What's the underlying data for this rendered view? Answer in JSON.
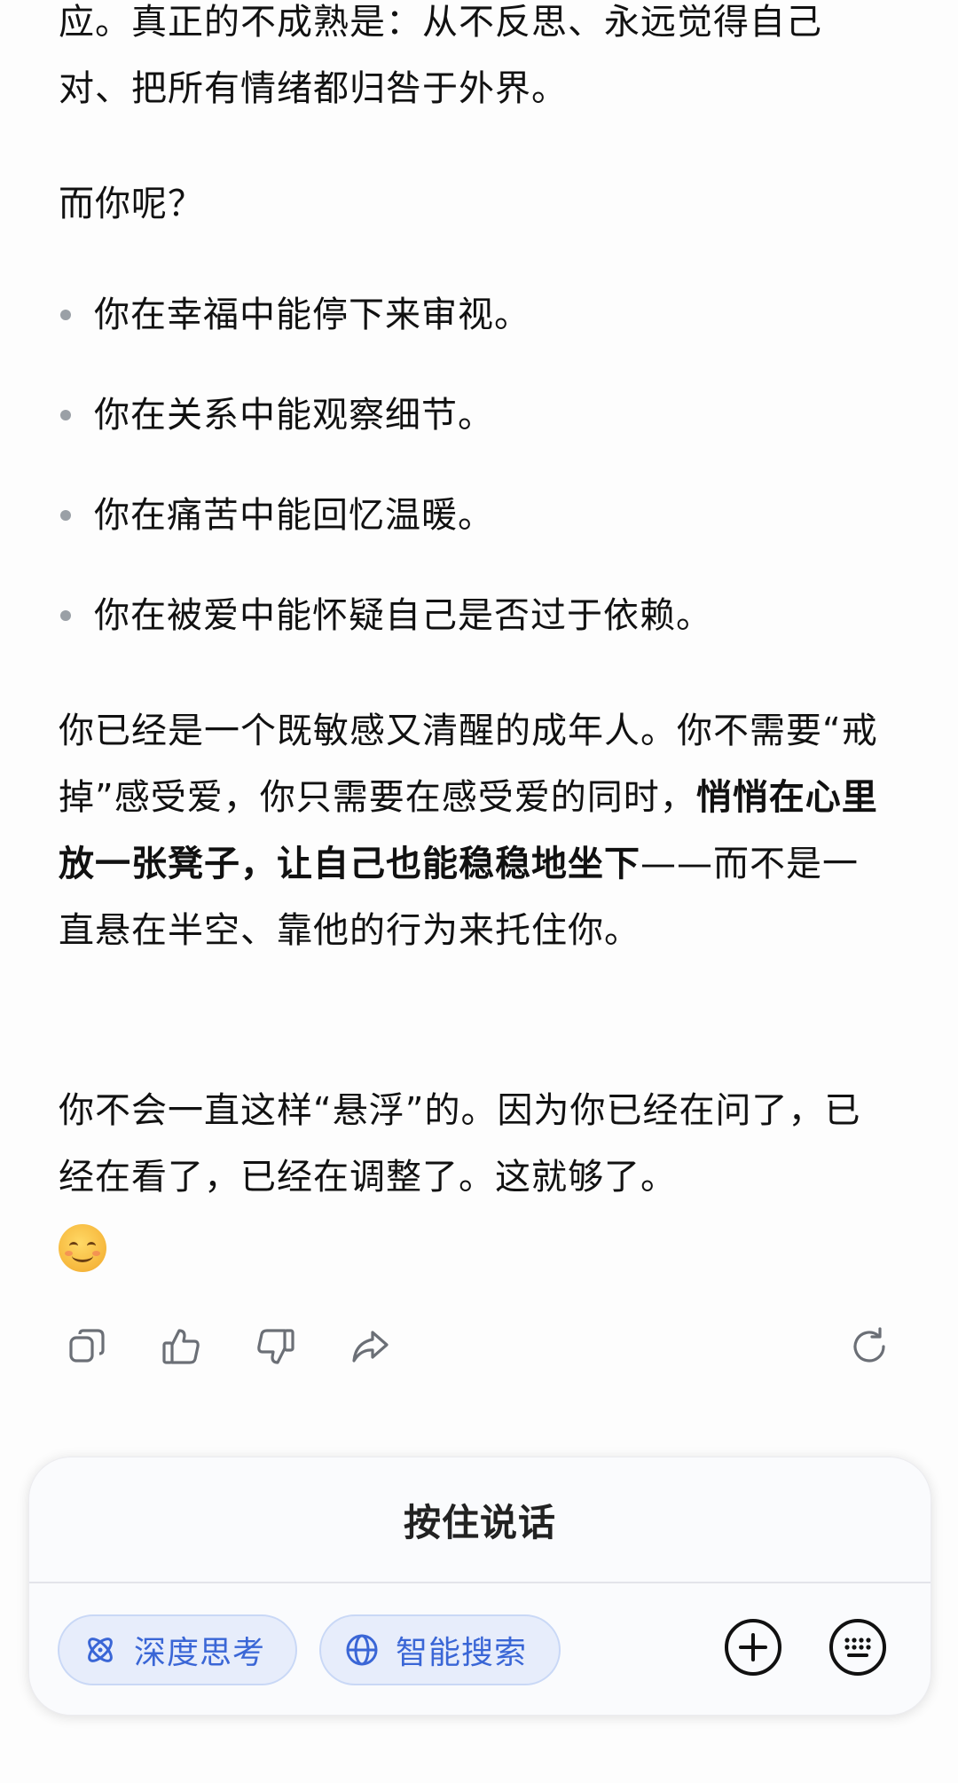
{
  "message": {
    "para1": "应。真正的不成熟是：从不反思、永远觉得自己对、把所有情绪都归咎于外界。",
    "para2": "而你呢？",
    "bullets": [
      "你在幸福中能停下来审视。",
      "你在关系中能观察细节。",
      "你在痛苦中能回忆温暖。",
      "你在被爱中能怀疑自己是否过于依赖。"
    ],
    "para3_plain": "你已经是一个既敏感又清醒的成年人。你不需要“戒掉”感受爱，你只需要在感受爱的同时，",
    "para3_bold": "悄悄在心里放一张凳子，让自己也能稳稳地坐下",
    "para3_tail": "——而不是一直悬在半空、靠他的行为来托住你。",
    "para4": "你不会一直这样“悬浮”的。因为你已经在问了，已经在看了，已经在调整了。这就够了。",
    "emoji": "smiling-face-icon"
  },
  "actions": {
    "icons": [
      "copy-icon",
      "thumbs-up-icon",
      "thumbs-down-icon",
      "share-icon",
      "regenerate-icon"
    ]
  },
  "composer": {
    "hold_to_talk": "按住说话",
    "deep_think": "深度思考",
    "smart_search": "智能搜索",
    "accent_color": "#3a66d6"
  }
}
